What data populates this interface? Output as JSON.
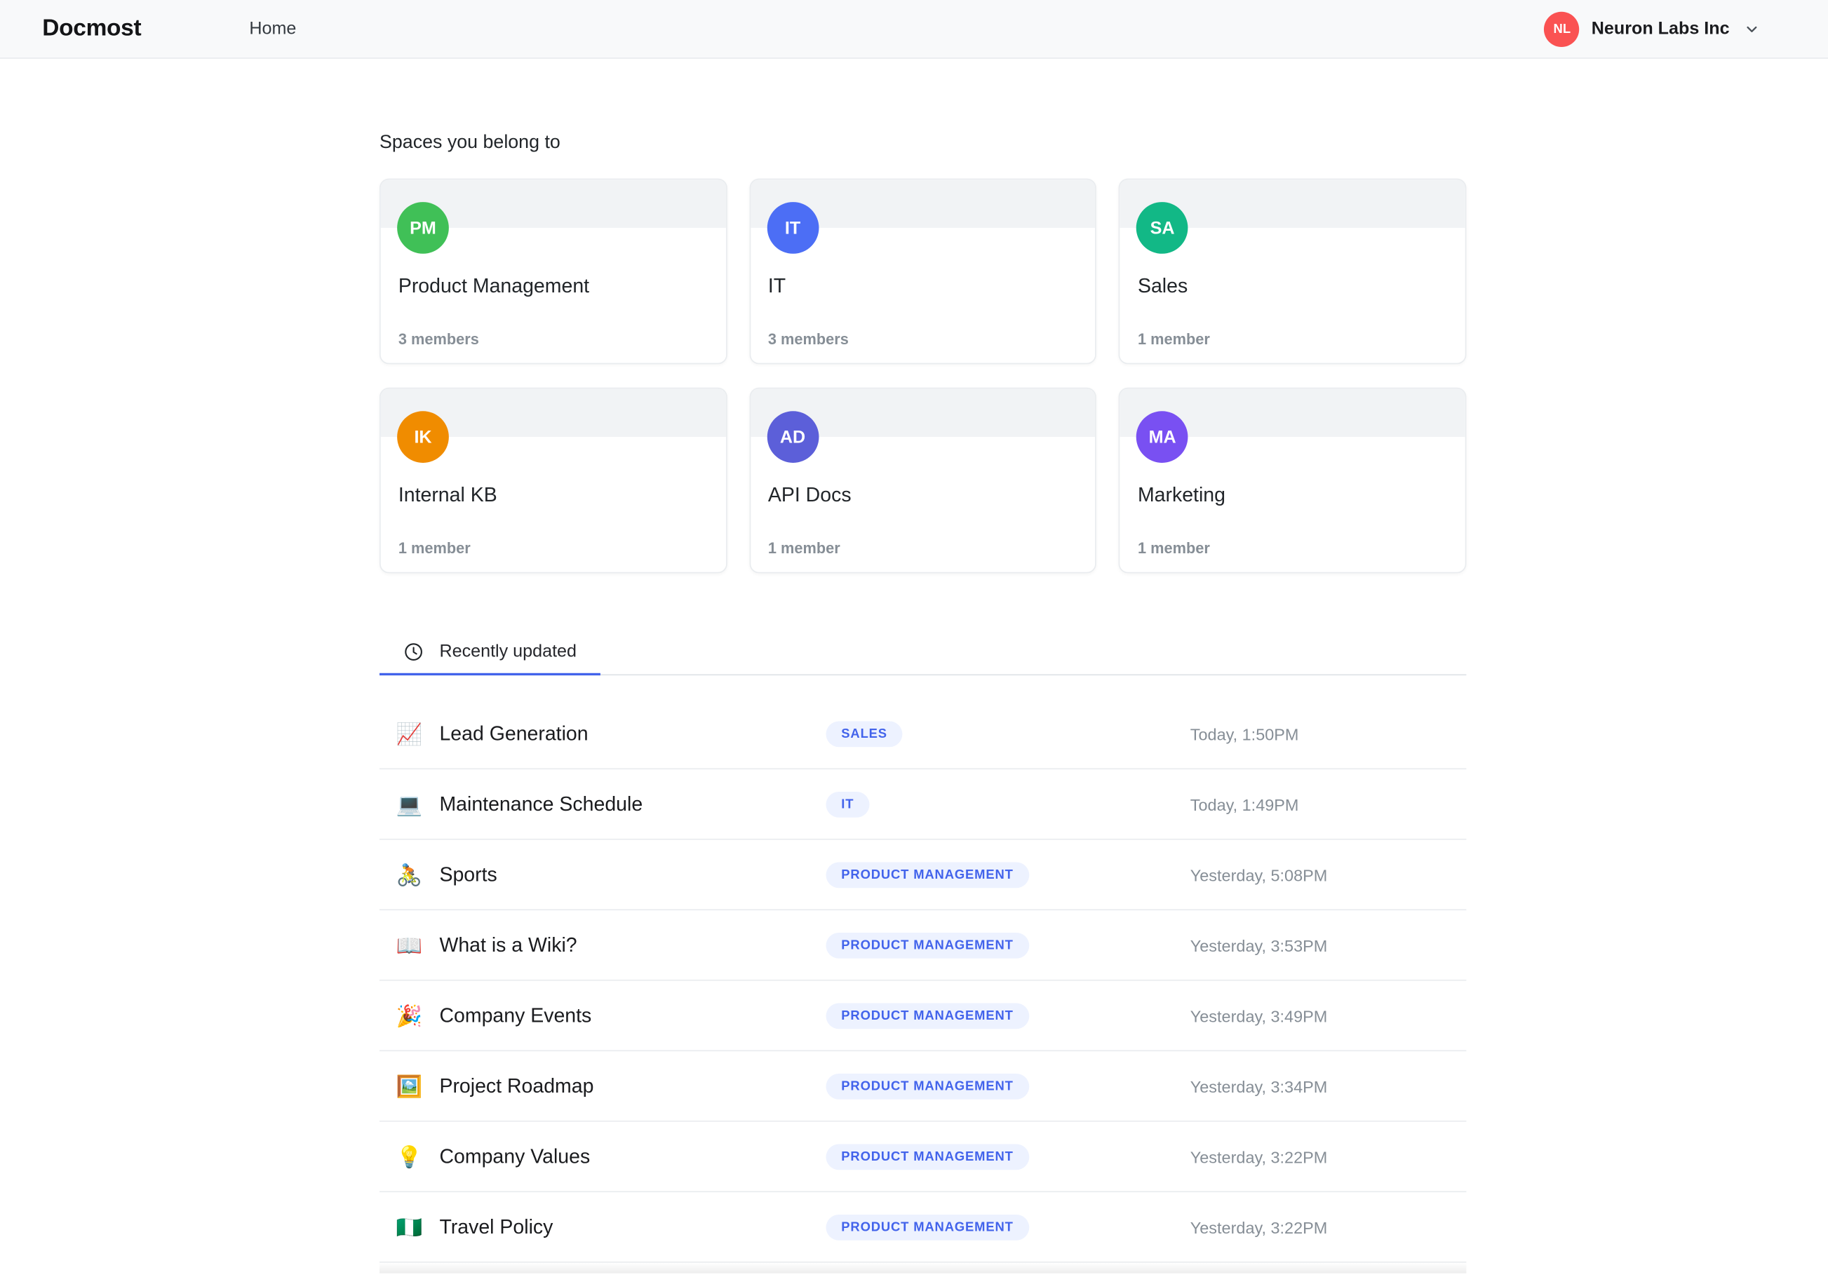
{
  "header": {
    "logo": "Docmost",
    "nav_home": "Home",
    "workspace": {
      "initials": "NL",
      "name": "Neuron Labs Inc",
      "avatar_color": "#fa5252"
    }
  },
  "spaces": {
    "heading": "Spaces you belong to",
    "cards": [
      {
        "initials": "PM",
        "color": "#40c057",
        "name": "Product Management",
        "members": "3 members"
      },
      {
        "initials": "IT",
        "color": "#4c6ef5",
        "name": "IT",
        "members": "3 members"
      },
      {
        "initials": "SA",
        "color": "#12b886",
        "name": "Sales",
        "members": "1 member"
      },
      {
        "initials": "IK",
        "color": "#f08c00",
        "name": "Internal KB",
        "members": "1 member"
      },
      {
        "initials": "AD",
        "color": "#5c5fd9",
        "name": "API Docs",
        "members": "1 member"
      },
      {
        "initials": "MA",
        "color": "#7950f2",
        "name": "Marketing",
        "members": "1 member"
      }
    ]
  },
  "tabs": {
    "recent_label": "Recently updated"
  },
  "recent": {
    "rows": [
      {
        "icon_name": "chart-increasing-emoji",
        "emoji": "📈",
        "title": "Lead Generation",
        "space": "SALES",
        "time": "Today, 1:50PM"
      },
      {
        "icon_name": "laptop-emoji",
        "emoji": "💻",
        "title": "Maintenance Schedule",
        "space": "IT",
        "time": "Today, 1:49PM"
      },
      {
        "icon_name": "person-biking-emoji",
        "emoji": "🚴",
        "title": "Sports",
        "space": "PRODUCT MANAGEMENT",
        "time": "Yesterday, 5:08PM"
      },
      {
        "icon_name": "open-book-emoji",
        "emoji": "📖",
        "title": "What is a Wiki?",
        "space": "PRODUCT MANAGEMENT",
        "time": "Yesterday, 3:53PM"
      },
      {
        "icon_name": "party-popper-emoji",
        "emoji": "🎉",
        "title": "Company Events",
        "space": "PRODUCT MANAGEMENT",
        "time": "Yesterday, 3:49PM"
      },
      {
        "icon_name": "framed-picture-emoji",
        "emoji": "🖼️",
        "title": "Project Roadmap",
        "space": "PRODUCT MANAGEMENT",
        "time": "Yesterday, 3:34PM"
      },
      {
        "icon_name": "light-bulb-emoji",
        "emoji": "💡",
        "title": "Company Values",
        "space": "PRODUCT MANAGEMENT",
        "time": "Yesterday, 3:22PM"
      },
      {
        "icon_name": "nigeria-flag-emoji",
        "emoji": "🇳🇬",
        "title": "Travel Policy",
        "space": "PRODUCT MANAGEMENT",
        "time": "Yesterday, 3:22PM"
      }
    ]
  }
}
